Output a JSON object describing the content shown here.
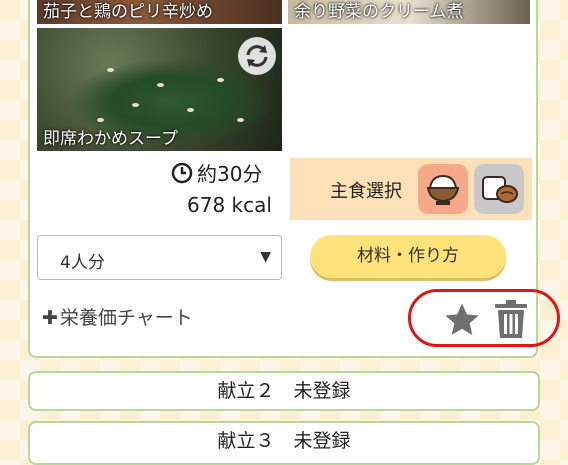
{
  "dishes": [
    {
      "name": "茄子と鶏のピリ辛炒め"
    },
    {
      "name": "余り野菜のクリーム煮"
    },
    {
      "name": "即席わかめスープ"
    }
  ],
  "info": {
    "time": "約30分",
    "calories": "678 kcal"
  },
  "staple": {
    "label": "主食選択",
    "options": [
      "rice-bowl-icon",
      "bread-icon"
    ]
  },
  "servings": {
    "selected": "4人分"
  },
  "recipe_button": "材料・作り方",
  "nutrition_link": "栄養価チャート",
  "menus": [
    {
      "label": "献立２　未登録"
    },
    {
      "label": "献立３　未登録"
    }
  ],
  "colors": {
    "card_border": "#b8d89a",
    "highlight": "#e01515",
    "button": "#ffe27a",
    "staple_bg": "#fbe0b8"
  }
}
